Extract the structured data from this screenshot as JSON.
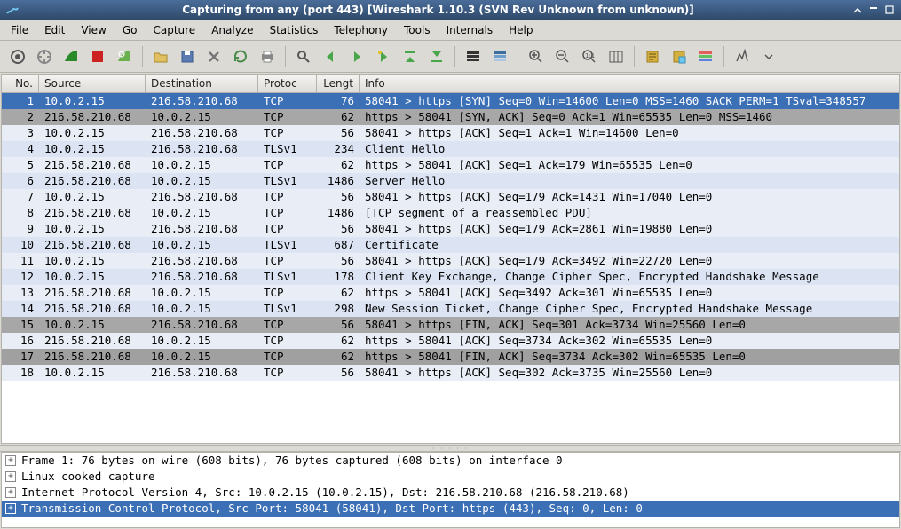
{
  "window": {
    "title": "Capturing from any (port 443)    [Wireshark 1.10.3  (SVN Rev Unknown from unknown)]"
  },
  "menu": [
    "File",
    "Edit",
    "View",
    "Go",
    "Capture",
    "Analyze",
    "Statistics",
    "Telephony",
    "Tools",
    "Internals",
    "Help"
  ],
  "toolbar_icons": [
    "list-interfaces-icon",
    "options-icon",
    "start-capture-icon",
    "stop-capture-icon",
    "restart-capture-icon",
    "sep",
    "open-file-icon",
    "save-file-icon",
    "close-file-icon",
    "reload-icon",
    "print-icon",
    "sep",
    "find-icon",
    "go-back-icon",
    "go-forward-icon",
    "go-to-icon",
    "go-first-icon",
    "go-last-icon",
    "sep",
    "colorize-icon",
    "auto-scroll-icon",
    "sep",
    "zoom-in-icon",
    "zoom-out-icon",
    "zoom-reset-icon",
    "resize-columns-icon",
    "sep",
    "capture-filters-icon",
    "display-filters-icon",
    "coloring-rules-icon",
    "sep",
    "prefs-icon"
  ],
  "columns": {
    "no": "No.",
    "src": "Source",
    "dst": "Destination",
    "proto": "Protoc",
    "len": "Lengt",
    "info": "Info"
  },
  "packets": [
    {
      "no": "1",
      "src": "10.0.2.15",
      "dst": "216.58.210.68",
      "proto": "TCP",
      "len": "76",
      "info": "58041 > https [SYN] Seq=0 Win=14600 Len=0 MSS=1460 SACK_PERM=1 TSval=348557",
      "cls": "row-selected"
    },
    {
      "no": "2",
      "src": "216.58.210.68",
      "dst": "10.0.2.15",
      "proto": "TCP",
      "len": "62",
      "info": "https > 58041 [SYN, ACK] Seq=0 Ack=1 Win=65535 Len=0 MSS=1460",
      "cls": "row-gray"
    },
    {
      "no": "3",
      "src": "10.0.2.15",
      "dst": "216.58.210.68",
      "proto": "TCP",
      "len": "56",
      "info": "58041 > https [ACK] Seq=1 Ack=1 Win=14600 Len=0",
      "cls": "row-tcp"
    },
    {
      "no": "4",
      "src": "10.0.2.15",
      "dst": "216.58.210.68",
      "proto": "TLSv1",
      "len": "234",
      "info": "Client Hello",
      "cls": "row-tls"
    },
    {
      "no": "5",
      "src": "216.58.210.68",
      "dst": "10.0.2.15",
      "proto": "TCP",
      "len": "62",
      "info": "https > 58041 [ACK] Seq=1 Ack=179 Win=65535 Len=0",
      "cls": "row-tcp"
    },
    {
      "no": "6",
      "src": "216.58.210.68",
      "dst": "10.0.2.15",
      "proto": "TLSv1",
      "len": "1486",
      "info": "Server Hello",
      "cls": "row-tls"
    },
    {
      "no": "7",
      "src": "10.0.2.15",
      "dst": "216.58.210.68",
      "proto": "TCP",
      "len": "56",
      "info": "58041 > https [ACK] Seq=179 Ack=1431 Win=17040 Len=0",
      "cls": "row-tcp"
    },
    {
      "no": "8",
      "src": "216.58.210.68",
      "dst": "10.0.2.15",
      "proto": "TCP",
      "len": "1486",
      "info": "[TCP segment of a reassembled PDU]",
      "cls": "row-tcp"
    },
    {
      "no": "9",
      "src": "10.0.2.15",
      "dst": "216.58.210.68",
      "proto": "TCP",
      "len": "56",
      "info": "58041 > https [ACK] Seq=179 Ack=2861 Win=19880 Len=0",
      "cls": "row-tcp"
    },
    {
      "no": "10",
      "src": "216.58.210.68",
      "dst": "10.0.2.15",
      "proto": "TLSv1",
      "len": "687",
      "info": "Certificate",
      "cls": "row-tls"
    },
    {
      "no": "11",
      "src": "10.0.2.15",
      "dst": "216.58.210.68",
      "proto": "TCP",
      "len": "56",
      "info": "58041 > https [ACK] Seq=179 Ack=3492 Win=22720 Len=0",
      "cls": "row-tcp"
    },
    {
      "no": "12",
      "src": "10.0.2.15",
      "dst": "216.58.210.68",
      "proto": "TLSv1",
      "len": "178",
      "info": "Client Key Exchange, Change Cipher Spec, Encrypted Handshake Message",
      "cls": "row-tls"
    },
    {
      "no": "13",
      "src": "216.58.210.68",
      "dst": "10.0.2.15",
      "proto": "TCP",
      "len": "62",
      "info": "https > 58041 [ACK] Seq=3492 Ack=301 Win=65535 Len=0",
      "cls": "row-tcp"
    },
    {
      "no": "14",
      "src": "216.58.210.68",
      "dst": "10.0.2.15",
      "proto": "TLSv1",
      "len": "298",
      "info": "New Session Ticket, Change Cipher Spec, Encrypted Handshake Message",
      "cls": "row-tls"
    },
    {
      "no": "15",
      "src": "10.0.2.15",
      "dst": "216.58.210.68",
      "proto": "TCP",
      "len": "56",
      "info": "58041 > https [FIN, ACK] Seq=301 Ack=3734 Win=25560 Len=0",
      "cls": "row-gray"
    },
    {
      "no": "16",
      "src": "216.58.210.68",
      "dst": "10.0.2.15",
      "proto": "TCP",
      "len": "62",
      "info": "https > 58041 [ACK] Seq=3734 Ack=302 Win=65535 Len=0",
      "cls": "row-tcp"
    },
    {
      "no": "17",
      "src": "216.58.210.68",
      "dst": "10.0.2.15",
      "proto": "TCP",
      "len": "62",
      "info": "https > 58041 [FIN, ACK] Seq=3734 Ack=302 Win=65535 Len=0",
      "cls": "row-darkgray"
    },
    {
      "no": "18",
      "src": "10.0.2.15",
      "dst": "216.58.210.68",
      "proto": "TCP",
      "len": "56",
      "info": "58041 > https [ACK] Seq=302 Ack=3735 Win=25560 Len=0",
      "cls": "row-tcp"
    }
  ],
  "tree": [
    {
      "text": "Frame 1: 76 bytes on wire (608 bits), 76 bytes captured (608 bits) on interface 0",
      "sel": false
    },
    {
      "text": "Linux cooked capture",
      "sel": false
    },
    {
      "text": "Internet Protocol Version 4, Src: 10.0.2.15 (10.0.2.15), Dst: 216.58.210.68 (216.58.210.68)",
      "sel": false
    },
    {
      "text": "Transmission Control Protocol, Src Port: 58041 (58041), Dst Port: https (443), Seq: 0, Len: 0",
      "sel": true
    }
  ]
}
